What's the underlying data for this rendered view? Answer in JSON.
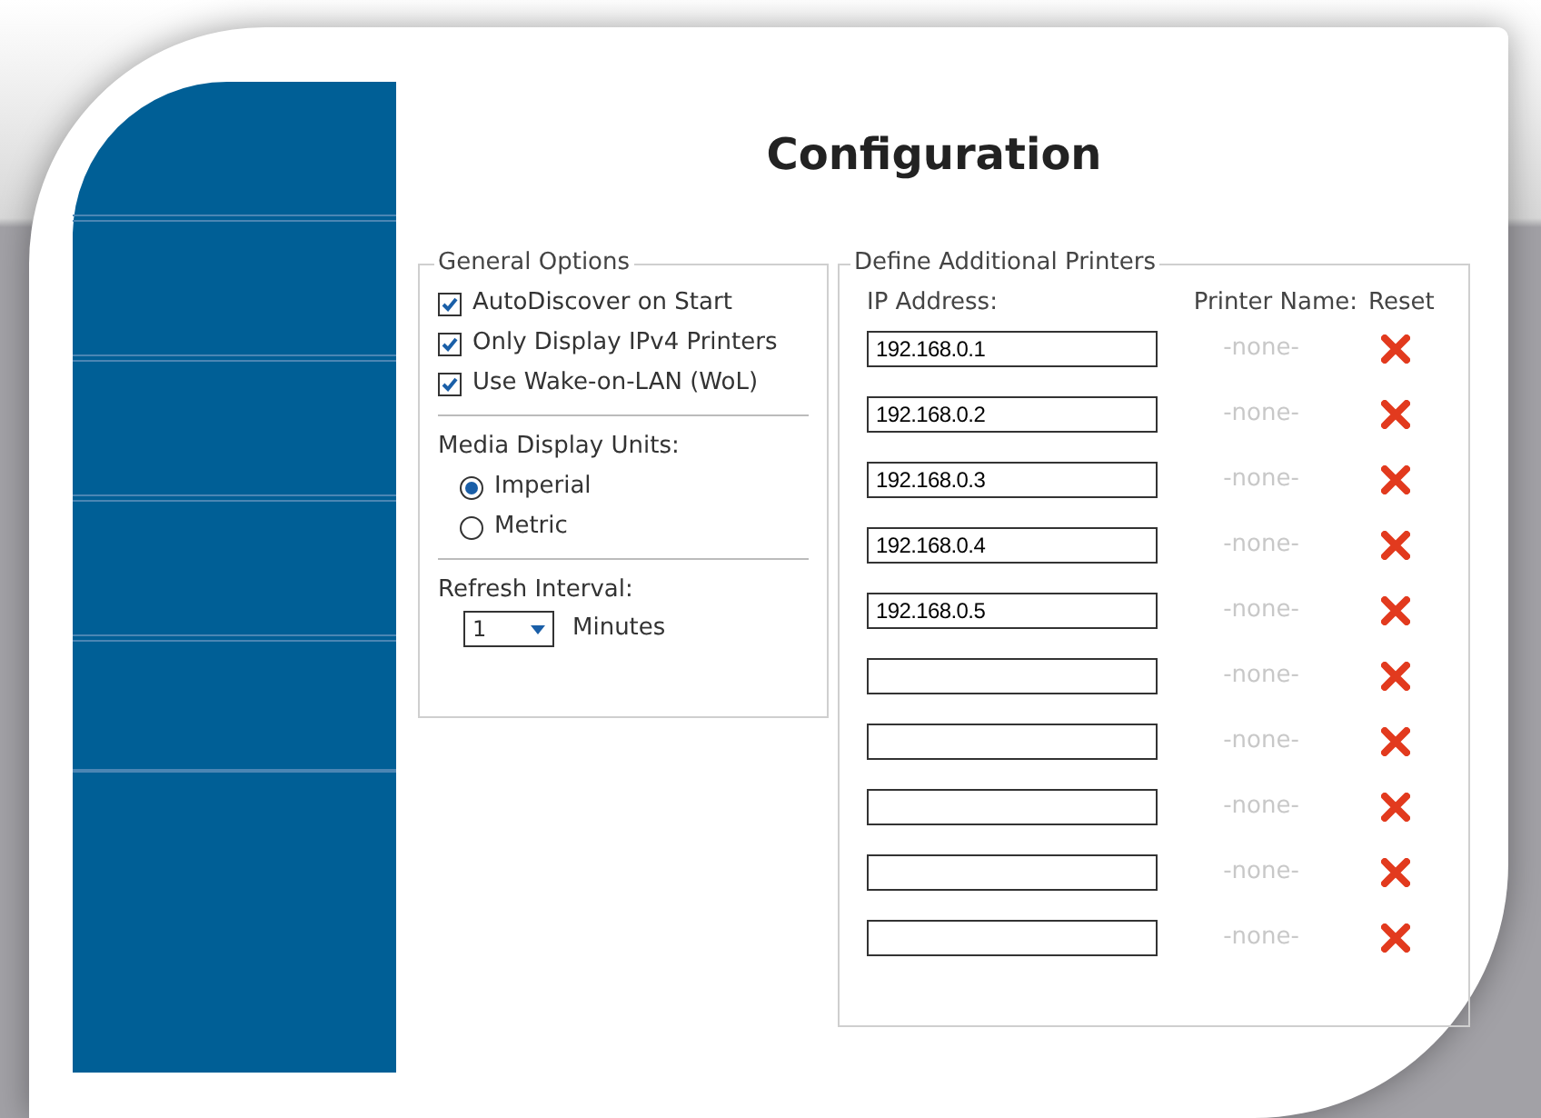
{
  "title": "Configuration",
  "general_options": {
    "legend": "General Options",
    "checkboxes": [
      {
        "label": "AutoDiscover on Start",
        "checked": true
      },
      {
        "label": "Only Display IPv4 Printers",
        "checked": true
      },
      {
        "label": "Use Wake-on-LAN (WoL)",
        "checked": true
      }
    ],
    "media_units": {
      "label": "Media Display Units:",
      "options": [
        {
          "label": "Imperial",
          "selected": true
        },
        {
          "label": "Metric",
          "selected": false
        }
      ]
    },
    "refresh": {
      "label": "Refresh Interval:",
      "value": "1",
      "unit": "Minutes"
    }
  },
  "printers": {
    "legend": "Define Additional Printers",
    "columns": [
      "IP Address:",
      "Printer Name:",
      "Reset"
    ],
    "rows": [
      {
        "ip": "192.168.0.1",
        "name": "-none-"
      },
      {
        "ip": "192.168.0.2",
        "name": "-none-"
      },
      {
        "ip": "192.168.0.3",
        "name": "-none-"
      },
      {
        "ip": "192.168.0.4",
        "name": "-none-"
      },
      {
        "ip": "192.168.0.5",
        "name": "-none-"
      },
      {
        "ip": "",
        "name": "-none-"
      },
      {
        "ip": "",
        "name": "-none-"
      },
      {
        "ip": "",
        "name": "-none-"
      },
      {
        "ip": "",
        "name": "-none-"
      },
      {
        "ip": "",
        "name": "-none-"
      }
    ]
  }
}
